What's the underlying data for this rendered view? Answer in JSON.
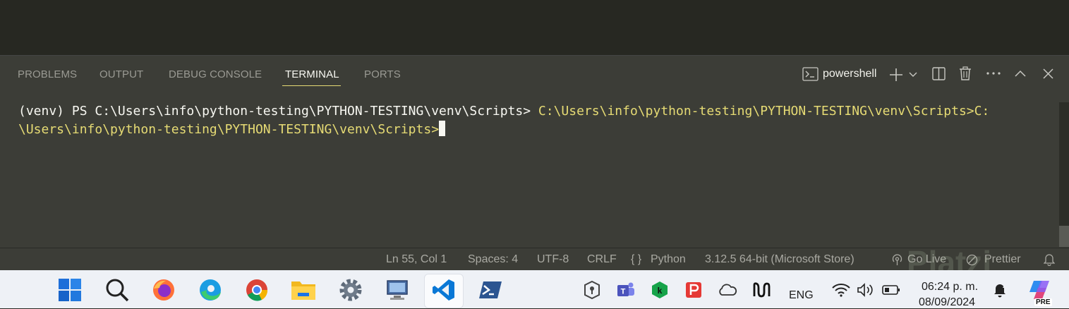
{
  "panel": {
    "tabs": [
      {
        "label": "PROBLEMS"
      },
      {
        "label": "OUTPUT"
      },
      {
        "label": "DEBUG CONSOLE"
      },
      {
        "label": "TERMINAL",
        "active": true
      },
      {
        "label": "PORTS"
      }
    ],
    "terminal_profile": "powershell"
  },
  "terminal": {
    "line1_prompt": "(venv) PS C:\\Users\\info\\python-testing\\PYTHON-TESTING\\venv\\Scripts> ",
    "line1_command": "C:\\Users\\info\\python-testing\\PYTHON-TESTING\\venv\\Scripts>C:",
    "line2_command": "\\Users\\info\\python-testing\\PYTHON-TESTING\\venv\\Scripts>"
  },
  "statusbar": {
    "position": "Ln 55, Col 1",
    "spaces": "Spaces: 4",
    "encoding": "UTF-8",
    "eol": "CRLF",
    "language_braces": "{ }",
    "language": "Python",
    "interpreter": "3.12.5 64-bit (Microsoft Store)",
    "go_live": "Go Live",
    "prettier": "Prettier"
  },
  "taskbar": {
    "language": "ENG",
    "time": "06:24 p. m.",
    "date": "08/09/2024",
    "copilot_badge": "PRE"
  },
  "watermark": "Platzi",
  "colors": {
    "panel_bg": "#3c3d37",
    "accent_yellow": "#e6db74",
    "taskbar_bg": "#eef1f6"
  },
  "icons": [
    "terminal-icon",
    "plus-icon",
    "chevron-down-icon",
    "split-icon",
    "trash-icon",
    "more-icon",
    "chevron-up-icon",
    "close-icon",
    "broadcast-icon",
    "prettier-icon",
    "bell-icon",
    "windows-start-icon",
    "search-icon",
    "firefox-icon",
    "edge-icon",
    "chrome-icon",
    "file-explorer-icon",
    "settings-icon",
    "remote-desktop-icon",
    "vscode-icon",
    "powershell-icon"
  ]
}
